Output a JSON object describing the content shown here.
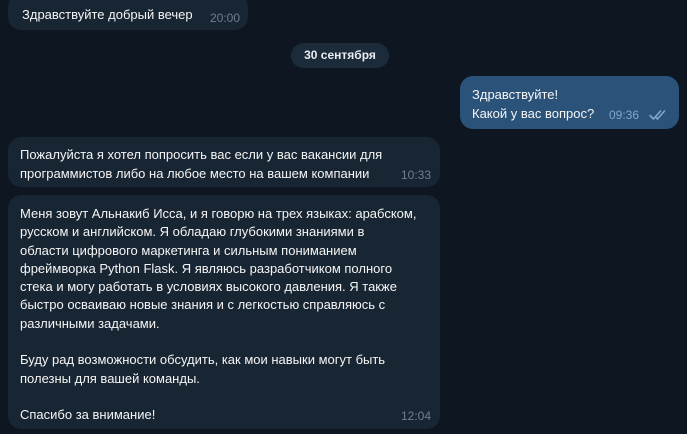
{
  "chat": {
    "date_separator": "30 сентября",
    "messages": [
      {
        "direction": "incoming",
        "text": "Здравствуйте добрый вечер",
        "time": "20:00"
      },
      {
        "direction": "outgoing",
        "text": "Здравствуйте!\nКакой у вас вопрос?",
        "time": "09:36",
        "status_icon": "double-check-icon"
      },
      {
        "direction": "incoming",
        "text": "Пожалуйста я хотел попросить вас если у вас вакансии для\nпрограммистов либо на любое место на вашем компании",
        "time": "10:33"
      },
      {
        "direction": "incoming",
        "text": "Меня зовут Альнакиб Исса, и я говорю на трех языках: арабском,\nрусском и английском. Я обладаю глубокими знаниями в\nобласти цифрового маркетинга и сильным пониманием\nфреймворка Python Flask. Я являюсь разработчиком полного\nстека и могу работать в условиях высокого давления. Я также\nбыстро осваиваю новые знания и с легкостью справляюсь с\nразличными задачами.\n\nБуду рад возможности обсудить, как мои навыки могут быть\nполезны для вашей команды.\n\nСпасибо за внимание!",
        "time": "12:04"
      }
    ]
  },
  "colors": {
    "background": "#0e1621",
    "incoming_bubble": "#182533",
    "outgoing_bubble": "#2b5278",
    "date_pill": "#1c2b3a",
    "read_check": "#7da8d3"
  }
}
